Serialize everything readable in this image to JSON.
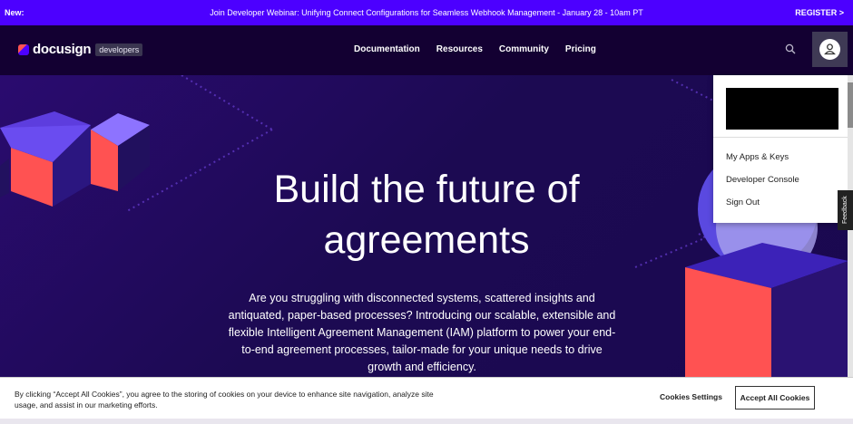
{
  "announcement": {
    "tag": "New:",
    "message": "Join Developer Webinar: Unifying Connect Configurations for Seamless Webhook Management - January 28 - 10am PT",
    "register": "REGISTER >"
  },
  "nav": {
    "logo": "docusign",
    "badge": "developers",
    "items": [
      "Documentation",
      "Resources",
      "Community",
      "Pricing"
    ]
  },
  "hero": {
    "title": "Build the future of agreements",
    "subtitle": "Are you struggling with disconnected systems, scattered insights and antiquated, paper-based processes? Introducing our scalable, extensible and flexible Intelligent Agreement Management (IAM) platform to power your end-to-end agreement processes, tailor-made for your unique needs to drive growth and efficiency."
  },
  "user_menu": {
    "items": [
      "My Apps & Keys",
      "Developer Console",
      "Sign Out"
    ]
  },
  "feedback": "Feedback",
  "cookie": {
    "text": "By clicking “Accept All Cookies”, you agree to the storing of cookies on your device to enhance site navigation, analyze site usage, and assist in our marketing efforts.",
    "settings": "Cookies Settings",
    "accept": "Accept All Cookies"
  },
  "colors": {
    "announcement_bg": "#4c00ff",
    "nav_bg": "#130032",
    "hero_bg": "#1e0e4a",
    "accent_coral": "#ff5252"
  }
}
